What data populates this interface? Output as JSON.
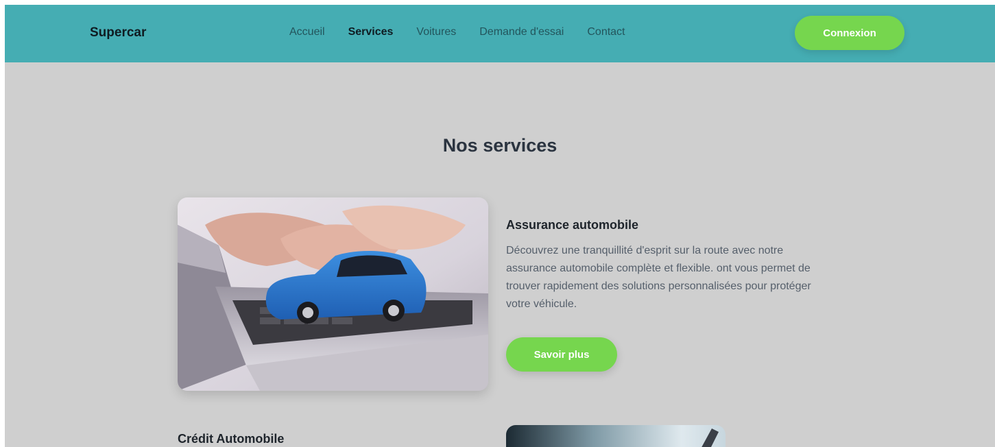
{
  "header": {
    "brand": "Supercar",
    "nav": [
      {
        "label": "Accueil",
        "active": false
      },
      {
        "label": "Services",
        "active": true
      },
      {
        "label": "Voitures",
        "active": false
      },
      {
        "label": "Demande d'essai",
        "active": false
      },
      {
        "label": "Contact",
        "active": false
      }
    ],
    "login_label": "Connexion"
  },
  "main": {
    "title": "Nos services",
    "services": [
      {
        "title": "Assurance automobile",
        "description": "Découvrez une tranquillité d'esprit sur la route avec notre assurance automobile complète et flexible. ont vous permet de trouver rapidement des solutions personnalisées pour protéger votre véhicule.",
        "button_label": "Savoir plus",
        "image_icon": "car-on-laptop-image"
      },
      {
        "title": "Crédit Automobile",
        "image_icon": "signing-document-image"
      }
    ]
  },
  "colors": {
    "navbar": "#45adb3",
    "background": "#cfcfcf",
    "accent_green": "#76d64e",
    "heading": "#2b3440"
  }
}
